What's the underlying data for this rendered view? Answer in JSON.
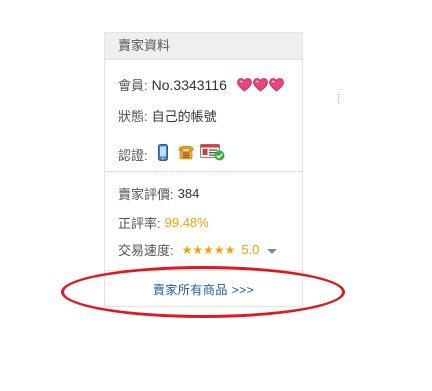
{
  "seller_panel": {
    "header_title": "賣家資料",
    "member_label": "會員:",
    "member_number": "No.3343116",
    "hearts": [
      "heart-icon",
      "heart-icon",
      "heart-icon"
    ],
    "status_label": "狀態:",
    "status_value": "自己的帳號",
    "cert_label": "認證:",
    "cert_icons": [
      "mobile-phone-icon",
      "telephone-icon",
      "id-card-verified-icon"
    ],
    "score_label": "賣家評價:",
    "score_value": "384",
    "positive_rate_label": "正評率:",
    "positive_rate_value": "99.48%",
    "speed_label": "交易速度:",
    "speed_stars": "★★★★★",
    "speed_value": "5.0",
    "all_products_link": "賣家所有商品 >>>"
  },
  "colors": {
    "accent_orange": "#f2a400",
    "link_blue": "#1a5ba8",
    "highlight_red": "#e0181f",
    "heart_pink": "#e8457a"
  }
}
